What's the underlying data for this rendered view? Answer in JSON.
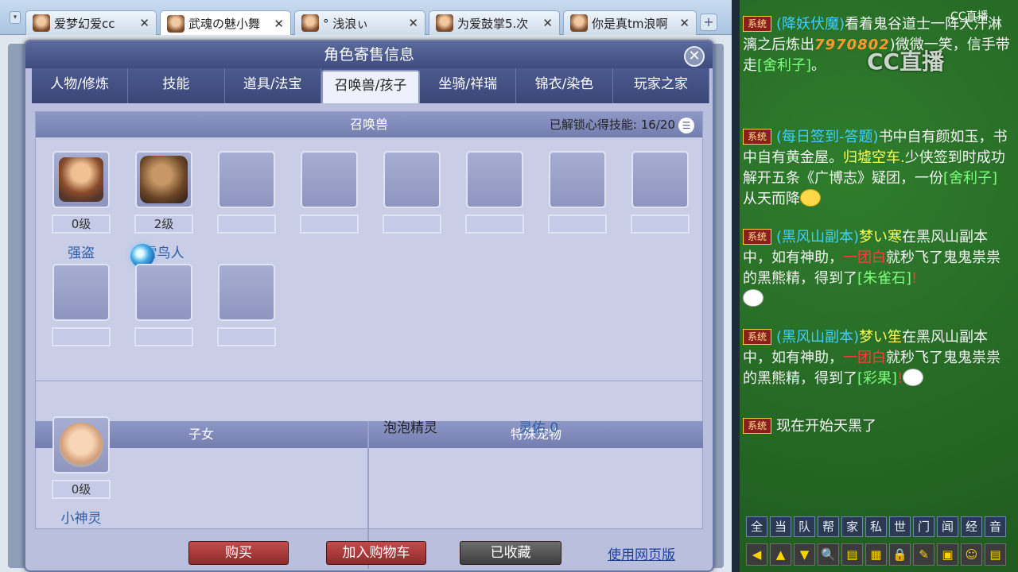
{
  "browser": {
    "tabs": [
      {
        "label": "爱梦幻爱cc",
        "close": "✕"
      },
      {
        "label": "武魂の魅小舞",
        "close": "✕"
      },
      {
        "label": "° 浅浪ぃ",
        "close": "✕"
      },
      {
        "label": "为爱鼓掌5.次",
        "close": "✕"
      },
      {
        "label": "你是真tm浪啊",
        "close": "✕"
      }
    ],
    "new_tab": "+",
    "scroll_arrow": "▾"
  },
  "window": {
    "title": "角色寄售信息",
    "close": "✕",
    "tabs": [
      "人物/修炼",
      "技能",
      "道具/法宝",
      "召唤兽/孩子",
      "坐骑/祥瑞",
      "锦衣/染色",
      "玩家之家"
    ]
  },
  "pets": {
    "header": "召唤兽",
    "unlock_label": "已解锁心得技能:",
    "unlock_value": "16/20",
    "list_icon": "☰",
    "items": [
      {
        "level": "0级",
        "name": "强盗"
      },
      {
        "level": "2级",
        "name": "雷鸟人"
      }
    ]
  },
  "children": {
    "header": "子女",
    "items": [
      {
        "level": "0级",
        "name": "小神灵"
      }
    ]
  },
  "special": {
    "header": "特殊宠物",
    "name": "泡泡精灵",
    "stat_label": "灵佑",
    "stat_value": "0"
  },
  "buttons": {
    "buy": "购买",
    "add_cart": "加入购物车",
    "favorited": "已收藏",
    "web_version": "使用网页版"
  },
  "chat": {
    "tag": "系统",
    "logo": "CC直播",
    "watermark": "CC直播",
    "m1_event": "(降妖伏魔)",
    "m1_a": "看着鬼谷道士一阵大汗淋漓之后炼出",
    "m1_num": "7970802",
    "m1_b": ")微微一笑，信手带走",
    "m1_item": "[舍利子]",
    "m1_end": "。",
    "m2_event": "(每日签到-答题)",
    "m2_a": "书中自有颜如玉，书中自有黄金屋。",
    "m2_player": "归墟空车.",
    "m2_b": "少侠签到时成功解开五条《广博志》疑团，一份",
    "m2_item": "[舍利子]",
    "m2_c": "从天而降",
    "m3_event": "(黑风山副本)",
    "m3_player": "梦い寒",
    "m3_a": "在黑风山副本中，如有神助，",
    "m3_blur": "一团白",
    "m3_b": "就秒飞了鬼鬼祟祟的黑熊精，得到了",
    "m3_item": "[朱雀石]",
    "m3_end": "!",
    "m4_event": "(黑风山副本)",
    "m4_player": "梦い笙",
    "m4_a": "在黑风山副本中，如有神助，",
    "m4_blur": "一团白",
    "m4_b": "就秒飞了鬼鬼祟祟的黑熊精，得到了",
    "m4_item": "[彩果]",
    "m4_end": "!",
    "m5": "现在开始天黑了",
    "channels": [
      "全",
      "当",
      "队",
      "帮",
      "家",
      "私",
      "世",
      "门",
      "闻",
      "经",
      "音"
    ],
    "tools": [
      "◀",
      "▲",
      "▼",
      "🔍",
      "▤",
      "▦",
      "🔒",
      "✎",
      "▣",
      "☺",
      "▤"
    ]
  },
  "colors": {
    "window_header": "#4c5a8e",
    "buy_btn": "#a33a3a",
    "fav_btn": "#555555",
    "chat_bg": "#2f7d2d"
  }
}
